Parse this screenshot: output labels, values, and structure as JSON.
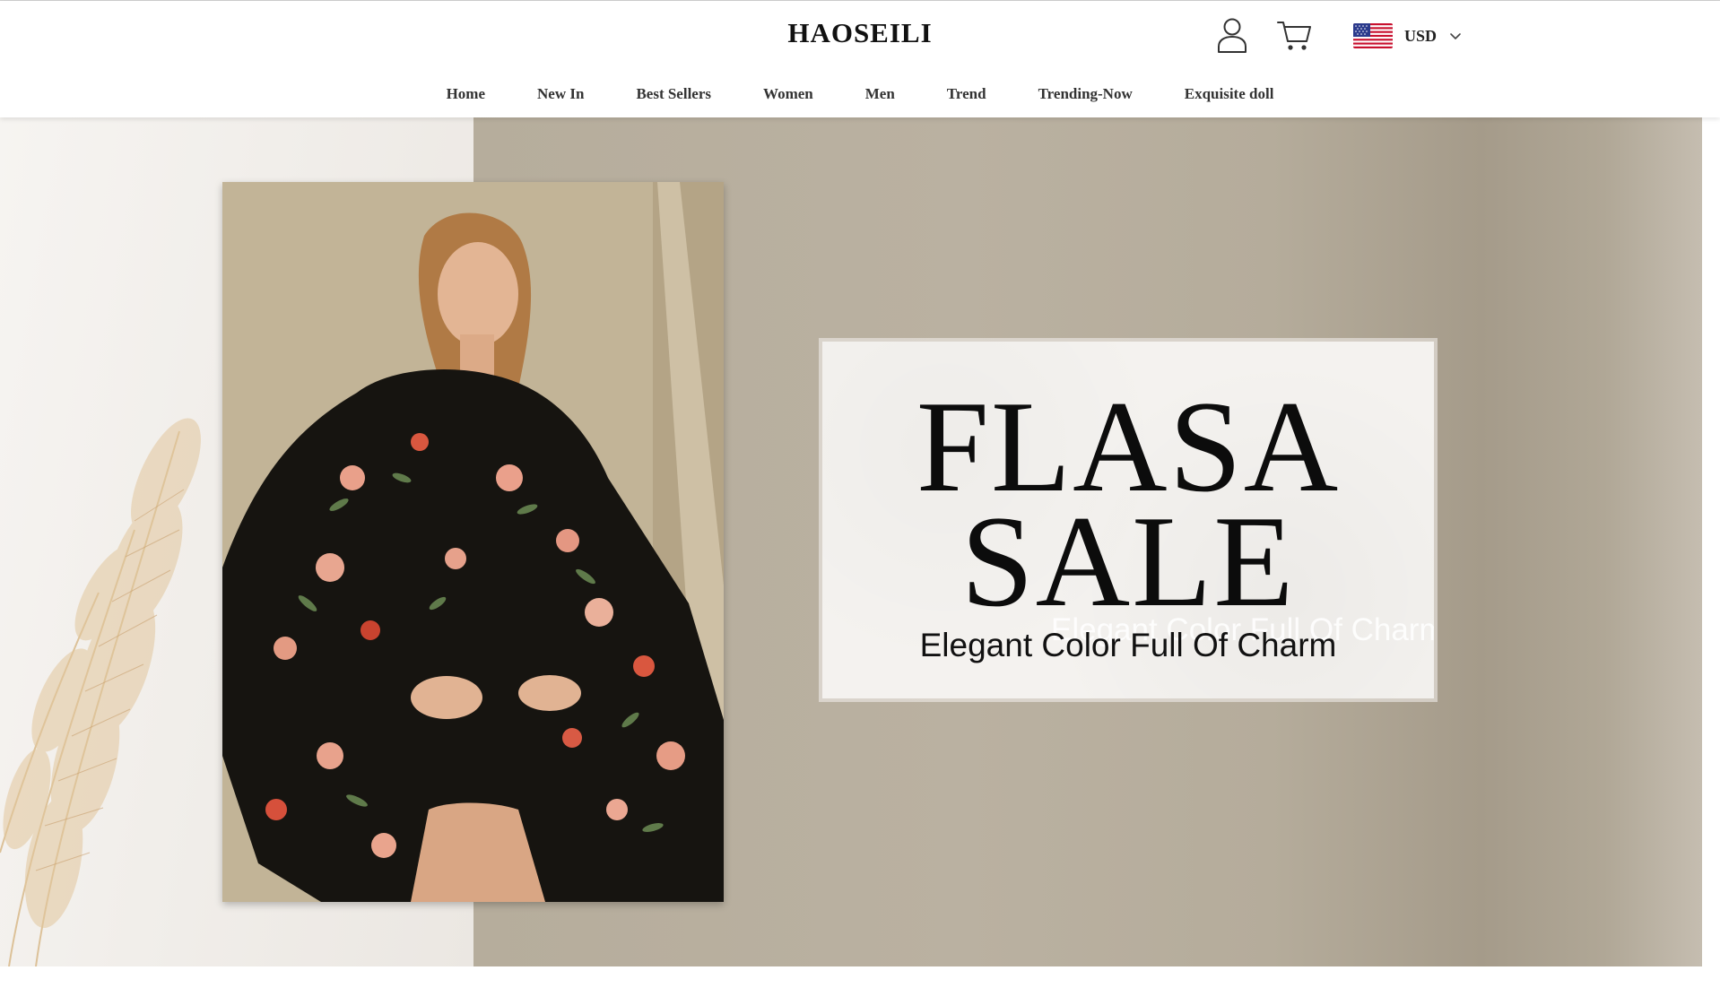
{
  "header": {
    "logo": "HAOSEILI",
    "user_icon": "user-icon",
    "cart_icon": "cart-icon",
    "currency": {
      "flag": "us-flag-icon",
      "code": "USD",
      "dropdown_icon": "chevron-down-icon"
    }
  },
  "nav": {
    "items": [
      {
        "label": "Home"
      },
      {
        "label": "New In"
      },
      {
        "label": "Best Sellers"
      },
      {
        "label": "Women"
      },
      {
        "label": "Men"
      },
      {
        "label": "Trend"
      },
      {
        "label": "Trending-Now"
      },
      {
        "label": "Exquisite doll"
      }
    ]
  },
  "hero": {
    "headline_line1": "FLASA",
    "headline_line2": "SALE",
    "subheadline": "Elegant Color Full Of Charm",
    "photo": "model-in-floral-dress-image",
    "decoration": "pampas-grass-image",
    "colors": {
      "backdrop": "#b6ad9c",
      "left_panel": "#f3f0ec",
      "card": "#f4f2ef"
    }
  }
}
